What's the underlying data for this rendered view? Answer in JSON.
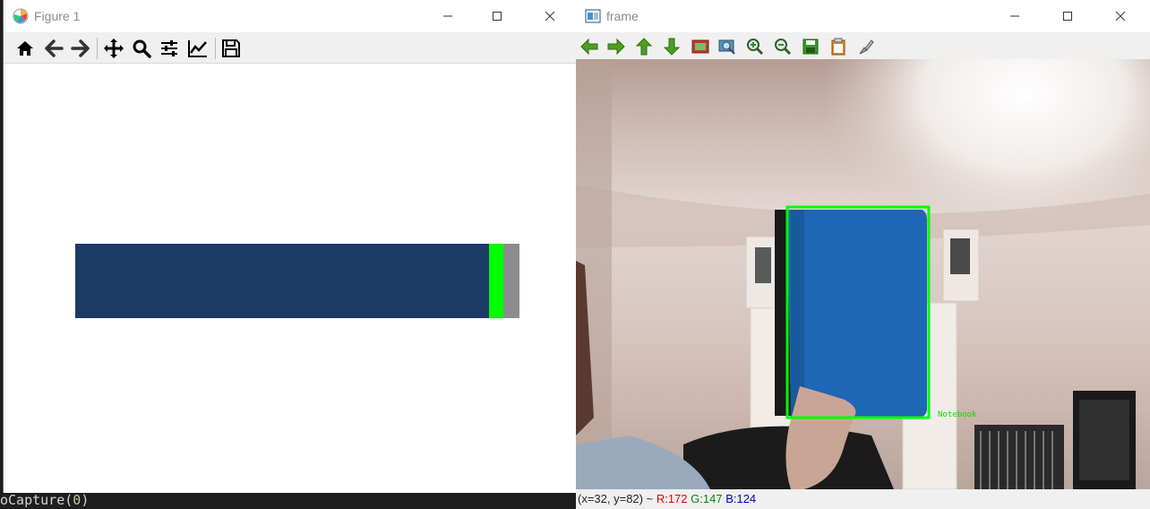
{
  "editor": {
    "code_prefix": "oCapture(",
    "code_arg": "0",
    "code_suffix": ")"
  },
  "figure_window": {
    "title": "Figure 1",
    "toolbar": [
      "home-icon",
      "back-arrow-icon",
      "forward-arrow-icon",
      "pan-icon",
      "zoom-icon",
      "configure-subplots-icon",
      "edit-axis-icon",
      "save-icon"
    ],
    "chart_data": {
      "type": "bar",
      "orientation": "horizontal-stacked",
      "categories": [
        ""
      ],
      "series": [
        {
          "values": [
            0.932
          ],
          "color": "#1b3a66"
        },
        {
          "values": [
            0.032
          ],
          "color": "#00ff00"
        },
        {
          "values": [
            0.036
          ],
          "color": "#8c8c8c"
        }
      ],
      "title": "",
      "xlabel": "",
      "ylabel": "",
      "grid": false,
      "axes_visible": false
    }
  },
  "frame_window": {
    "title": "frame",
    "toolbar": [
      "pan-left-icon",
      "pan-right-icon",
      "pan-up-icon",
      "pan-down-icon",
      "zoom-fit-icon",
      "zoom-image-icon",
      "zoom-in-icon",
      "zoom-out-icon",
      "save-image-icon",
      "copy-clipboard-icon",
      "properties-icon"
    ],
    "detection_label": "Notebook",
    "box_color": "#00ff00",
    "status": {
      "coords": "(x=32, y=82) ~ ",
      "r": "R:172",
      "g": "G:147",
      "b": "B:124"
    }
  }
}
